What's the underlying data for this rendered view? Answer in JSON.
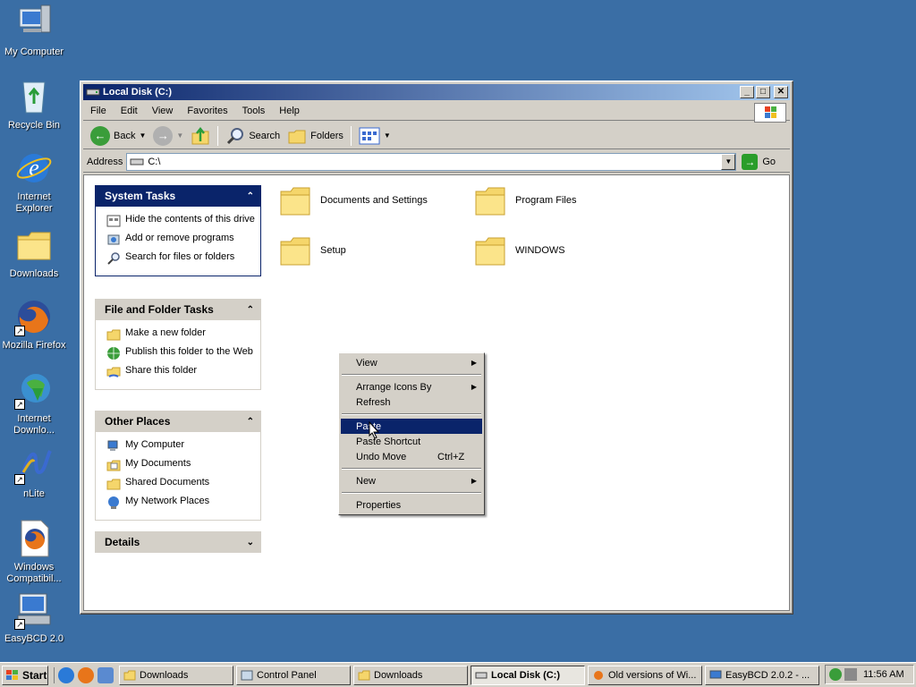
{
  "desktop": {
    "icons": [
      {
        "label": "My Computer",
        "icon": "my-computer-icon"
      },
      {
        "label": "Recycle Bin",
        "icon": "recycle-bin-icon"
      },
      {
        "label": "Internet Explorer",
        "icon": "internet-explorer-icon"
      },
      {
        "label": "Downloads",
        "icon": "folder-icon"
      },
      {
        "label": "Mozilla Firefox",
        "icon": "firefox-icon"
      },
      {
        "label": "Internet Downlo...",
        "icon": "internet-download-manager-icon"
      },
      {
        "label": "nLite",
        "icon": "nlite-icon"
      },
      {
        "label": "Windows Compatibil...",
        "icon": "firefox-doc-icon"
      },
      {
        "label": "EasyBCD 2.0",
        "icon": "easybcd-icon"
      }
    ]
  },
  "window": {
    "title": "Local Disk (C:)",
    "controls": {
      "minimize": "_",
      "maximize": "□",
      "close": "✕"
    },
    "menu": [
      "File",
      "Edit",
      "View",
      "Favorites",
      "Tools",
      "Help"
    ],
    "toolbar": {
      "back": "Back",
      "search": "Search",
      "folders": "Folders"
    },
    "address": {
      "label": "Address",
      "value": "C:\\",
      "go": "Go"
    }
  },
  "tasks": {
    "system": {
      "title": "System Tasks",
      "items": [
        "Hide the contents of this drive",
        "Add or remove programs",
        "Search for files or folders"
      ]
    },
    "file_folder": {
      "title": "File and Folder Tasks",
      "items": [
        "Make a new folder",
        "Publish this folder to the Web",
        "Share this folder"
      ]
    },
    "other": {
      "title": "Other Places",
      "items": [
        "My Computer",
        "My Documents",
        "Shared Documents",
        "My Network Places"
      ]
    },
    "details": {
      "title": "Details"
    }
  },
  "folders": [
    "Documents and Settings",
    "Program Files",
    "Setup",
    "WINDOWS"
  ],
  "context_menu": {
    "items": [
      {
        "label": "View",
        "submenu": true
      },
      {
        "label": "Arrange Icons By",
        "submenu": true
      },
      {
        "label": "Refresh"
      },
      {
        "label": "Paste",
        "highlighted": true
      },
      {
        "label": "Paste Shortcut"
      },
      {
        "label": "Undo Move",
        "shortcut": "Ctrl+Z"
      },
      {
        "label": "New",
        "submenu": true
      },
      {
        "label": "Properties"
      }
    ]
  },
  "taskbar": {
    "start": "Start",
    "tasks": [
      "Downloads",
      "Control Panel",
      "Downloads",
      "Local Disk (C:)",
      "Old versions of Wi...",
      "EasyBCD 2.0.2 - ..."
    ],
    "active_task": 3,
    "clock": "11:56 AM"
  },
  "colors": {
    "desktop": "#3a6ea5",
    "title_active": "#0a246a",
    "highlight": "#0a246a",
    "folder": "#f5d66b"
  }
}
